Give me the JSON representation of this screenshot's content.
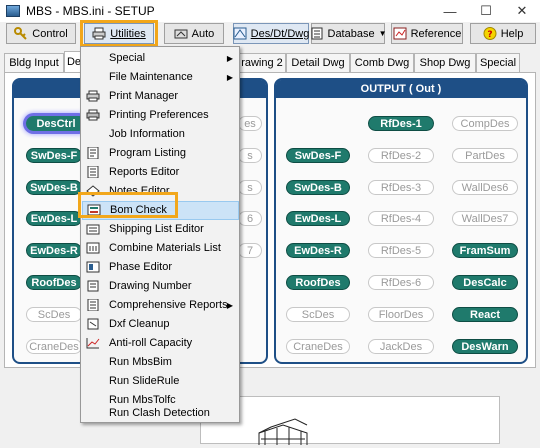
{
  "window": {
    "title": "MBS - MBS.ini - SETUP",
    "controls": {
      "minimize": "—",
      "maximize": "☐",
      "close": "✕"
    }
  },
  "toolbar": {
    "control": "Control",
    "utilities": "Utilities",
    "auto": "Auto",
    "des_dt_dwg": "Des/Dt/Dwg",
    "database": "Database",
    "reference": "Reference",
    "help": "Help"
  },
  "tabs": [
    "Bldg Input",
    "De",
    "rawing 2",
    "Detail Dwg",
    "Comb Dwg",
    "Shop Dwg",
    "Special"
  ],
  "input_panel": {
    "buttons": [
      {
        "label": "DesCtrl",
        "state": "selected"
      },
      {
        "label": "es",
        "state": "off"
      },
      {
        "label": "SwDes-F",
        "state": "on"
      },
      {
        "label": "s",
        "state": "off"
      },
      {
        "label": "SwDes-B",
        "state": "on"
      },
      {
        "label": "s",
        "state": "off"
      },
      {
        "label": "EwDes-L",
        "state": "on"
      },
      {
        "label": "6",
        "state": "off"
      },
      {
        "label": "EwDes-R",
        "state": "on"
      },
      {
        "label": "7",
        "state": "off"
      },
      {
        "label": "RoofDes",
        "state": "on"
      },
      {
        "label": "ScDes",
        "state": "off"
      },
      {
        "label": "CraneDes",
        "state": "off"
      }
    ]
  },
  "output_panel": {
    "header": "OUTPUT ( Out )",
    "buttons": [
      {
        "label": "RfDes-1",
        "state": "on"
      },
      {
        "label": "CompDes",
        "state": "off"
      },
      {
        "label": "SwDes-F",
        "state": "on"
      },
      {
        "label": "RfDes-2",
        "state": "off"
      },
      {
        "label": "PartDes",
        "state": "off"
      },
      {
        "label": "SwDes-B",
        "state": "on"
      },
      {
        "label": "RfDes-3",
        "state": "off"
      },
      {
        "label": "WallDes6",
        "state": "off"
      },
      {
        "label": "EwDes-L",
        "state": "on"
      },
      {
        "label": "RfDes-4",
        "state": "off"
      },
      {
        "label": "WallDes7",
        "state": "off"
      },
      {
        "label": "EwDes-R",
        "state": "on"
      },
      {
        "label": "RfDes-5",
        "state": "off"
      },
      {
        "label": "FramSum",
        "state": "on"
      },
      {
        "label": "RoofDes",
        "state": "on"
      },
      {
        "label": "RfDes-6",
        "state": "off"
      },
      {
        "label": "DesCalc",
        "state": "on"
      },
      {
        "label": "ScDes",
        "state": "off"
      },
      {
        "label": "FloorDes",
        "state": "off"
      },
      {
        "label": "React",
        "state": "on"
      },
      {
        "label": "CraneDes",
        "state": "off"
      },
      {
        "label": "JackDes",
        "state": "off"
      },
      {
        "label": "DesWarn",
        "state": "on"
      }
    ]
  },
  "utilities_menu": {
    "items": [
      {
        "label": "Special",
        "submenu": true,
        "icon": "none"
      },
      {
        "label": "File Maintenance",
        "submenu": true,
        "icon": "none"
      },
      {
        "label": "Print Manager",
        "icon": "printer-icon"
      },
      {
        "label": "Printing Preferences",
        "icon": "printer-settings-icon"
      },
      {
        "label": "Job Information",
        "icon": "none"
      },
      {
        "label": "Program Listing",
        "icon": "listing-icon"
      },
      {
        "label": "Reports Editor",
        "icon": "report-icon"
      },
      {
        "label": "Notes Editor",
        "icon": "notes-icon"
      },
      {
        "label": "Bom Check",
        "icon": "bom-icon",
        "highlighted": true
      },
      {
        "label": "Shipping List Editor",
        "icon": "shipping-icon"
      },
      {
        "label": "Combine Materials List",
        "icon": "combine-icon"
      },
      {
        "label": "Phase Editor",
        "icon": "phase-icon"
      },
      {
        "label": "Drawing Number",
        "icon": "drawing-number-icon"
      },
      {
        "label": "Comprehensive Reports",
        "submenu": true,
        "icon": "comprehensive-icon"
      },
      {
        "label": "Dxf Cleanup",
        "icon": "dxf-icon"
      },
      {
        "label": "Anti-roll Capacity",
        "icon": "chart-icon"
      },
      {
        "label": "Run MbsBim",
        "icon": "none"
      },
      {
        "label": "Run SlideRule",
        "icon": "none"
      },
      {
        "label": "Run MbsTolfc",
        "icon": "none"
      },
      {
        "label": "Run Clash Detection",
        "icon": "none"
      }
    ]
  },
  "colors": {
    "accent_teal": "#1f7a6c",
    "panel_blue": "#1e4f86",
    "highlight_orange": "#f2a71b",
    "menu_hover": "#cce3f7"
  }
}
